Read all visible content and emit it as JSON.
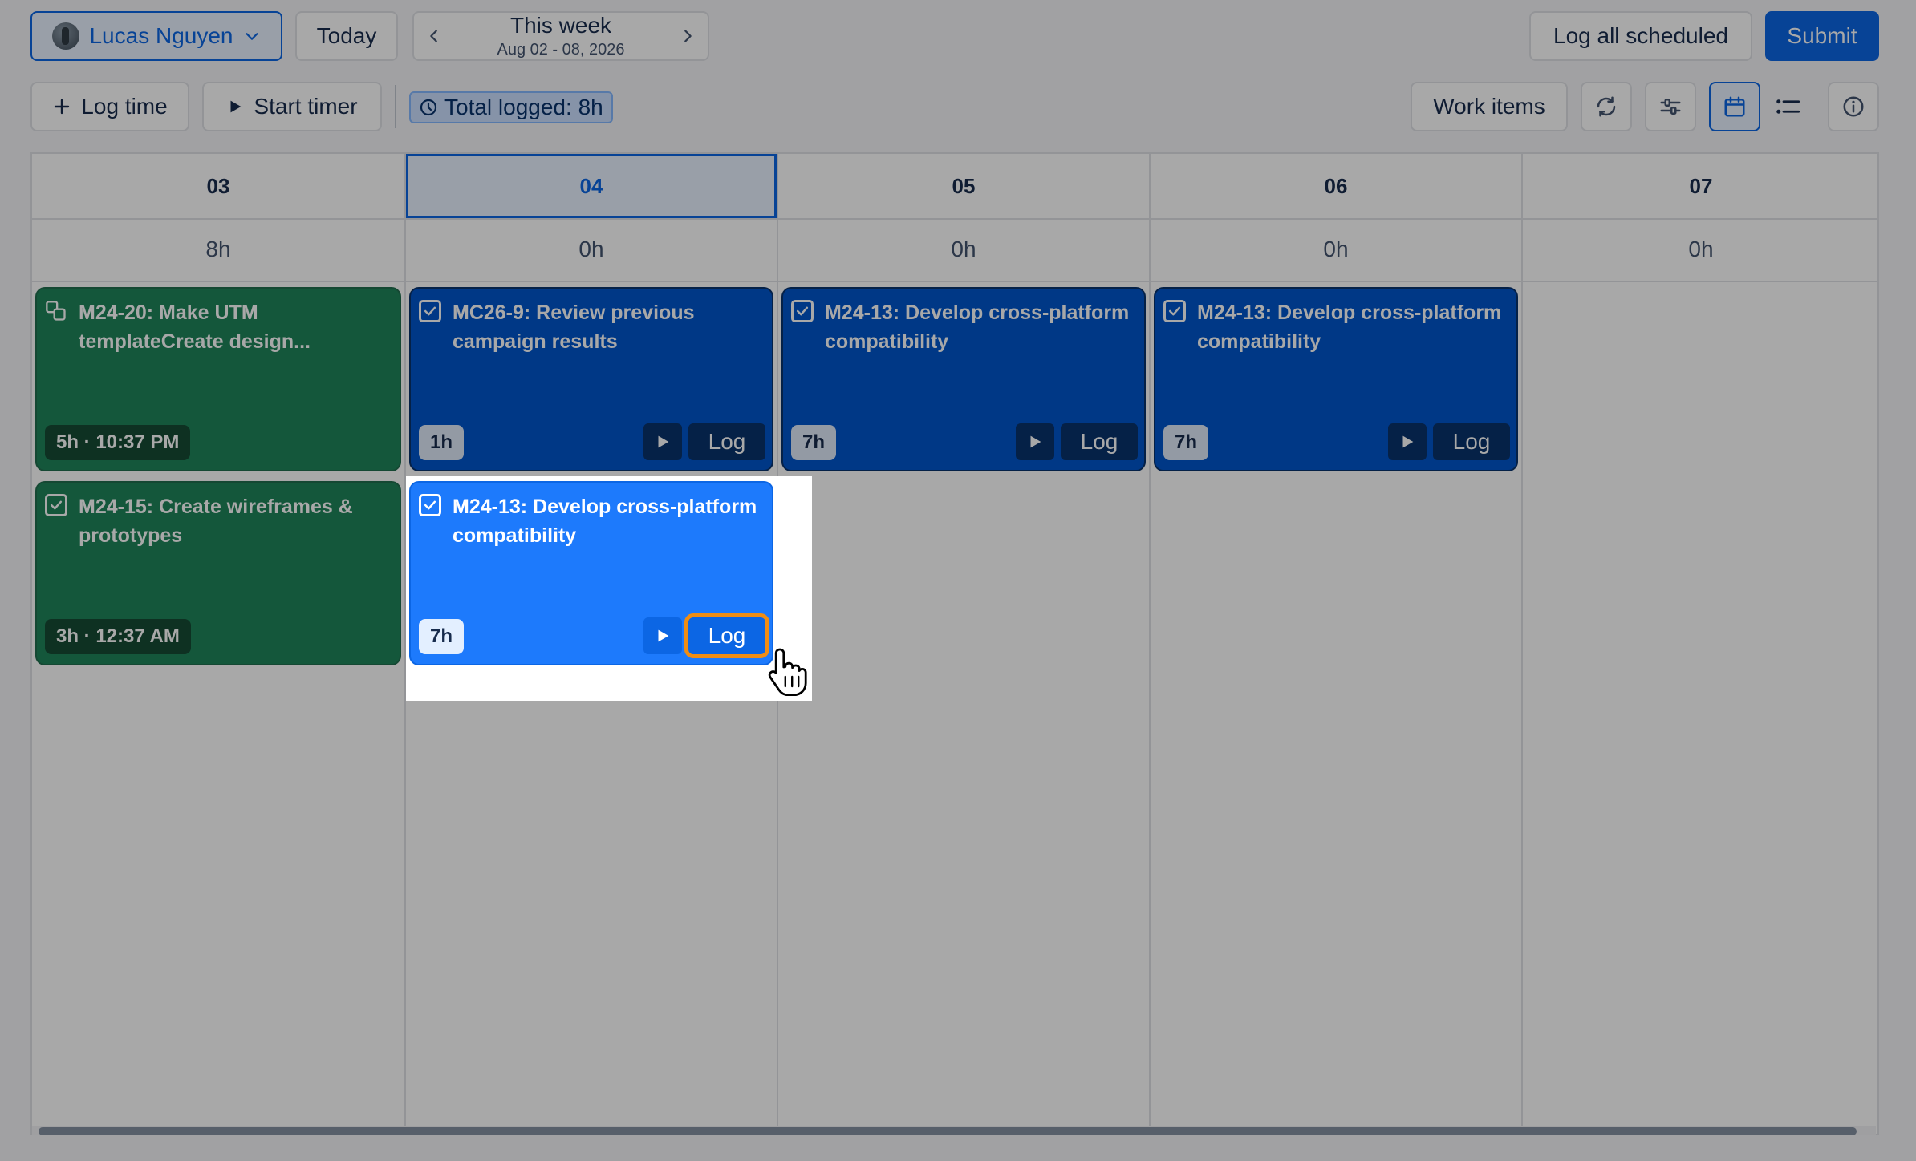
{
  "toolbar": {
    "user_name": "Lucas Nguyen",
    "today_label": "Today",
    "week_title": "This week",
    "week_range": "Aug 02 - 08, 2026",
    "log_all_label": "Log all scheduled",
    "submit_label": "Submit",
    "log_time_label": "Log time",
    "start_timer_label": "Start timer",
    "total_logged_label": "Total logged: 8h",
    "work_items_label": "Work items"
  },
  "calendar": {
    "days": [
      {
        "label": "03",
        "total": "8h"
      },
      {
        "label": "04",
        "total": "0h"
      },
      {
        "label": "05",
        "total": "0h"
      },
      {
        "label": "06",
        "total": "0h"
      },
      {
        "label": "07",
        "total": "0h"
      }
    ],
    "cards": [
      {
        "title": "M24-20: Make UTM templateCreate design...",
        "chip": "5h · 10:37 PM"
      },
      {
        "title": "M24-15: Create wireframes & prototypes",
        "chip": "3h · 12:37 AM"
      },
      {
        "title": "MC26-9: Review previous campaign results",
        "chip": "1h",
        "log": "Log"
      },
      {
        "title": "M24-13: Develop cross-platform compatibility",
        "chip": "7h",
        "log": "Log"
      },
      {
        "title": "M24-13: Develop cross-platform compatibility",
        "chip": "7h",
        "log": "Log"
      },
      {
        "title": "M24-13: Develop cross-platform compatibility",
        "chip": "7h",
        "log": "Log"
      }
    ]
  },
  "colors": {
    "primary": "#0c66e4",
    "green_card": "#1f845a",
    "blue_card": "#0055cc",
    "focus_outline": "#f18d13"
  }
}
